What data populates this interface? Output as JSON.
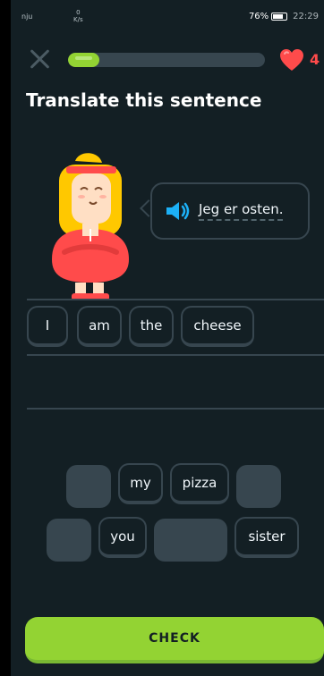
{
  "status_bar": {
    "carrier": "nju",
    "speed_value": "0",
    "speed_unit": "K/s",
    "battery": "76%",
    "time": "22:29"
  },
  "lesson": {
    "progress": 0.16,
    "hearts": "4",
    "title": "Translate this sentence"
  },
  "prompt": {
    "sentence": "Jeg er osten."
  },
  "answer_words": [
    "I",
    "am",
    "the",
    "cheese"
  ],
  "bank_row1": [
    "",
    "my",
    "pizza",
    ""
  ],
  "bank_row2": [
    "",
    "you",
    "",
    "sister"
  ],
  "check_label": "CHECK",
  "colors": {
    "background": "#131f24",
    "accent_green": "#93d333",
    "heart_red": "#ff4b4b",
    "border": "#37464f",
    "speaker_blue": "#1cb0f6"
  }
}
